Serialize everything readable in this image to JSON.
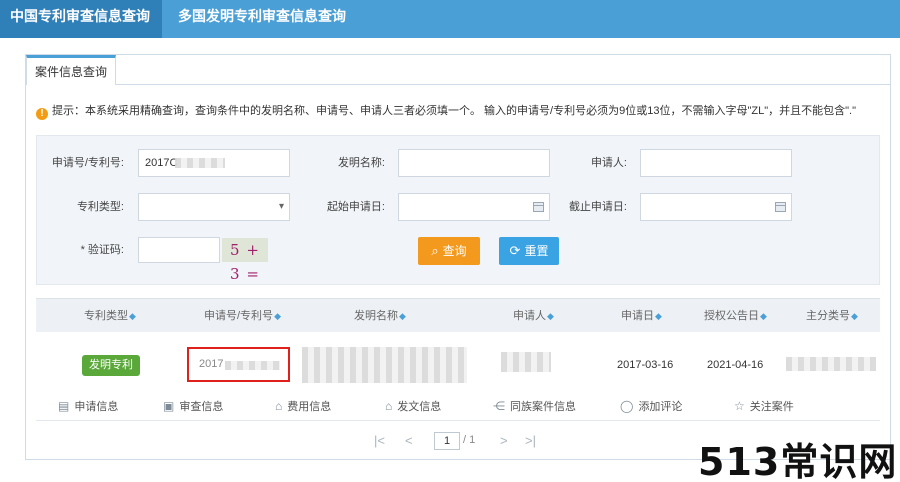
{
  "top_tabs": {
    "active": "中国专利审查信息查询",
    "other": "多国发明专利审查信息查询"
  },
  "panel_tab": "案件信息查询",
  "tip": {
    "icon": "warning-icon",
    "text": "提示：本系统采用精确查询，查询条件中的发明名称、申请号、申请人三者必须填一个。 输入的申请号/专利号必须为9位或13位，不需输入字母\"ZL\"，并且不能包含\".\""
  },
  "form": {
    "app_no_label": "申请号/专利号:",
    "app_no_value": "2017C",
    "invention_label": "发明名称:",
    "applicant_label": "申请人:",
    "type_label": "专利类型:",
    "start_date_label": "起始申请日:",
    "end_date_label": "截止申请日:",
    "captcha_label": "* 验证码:",
    "captcha_image": "5 + 3 =",
    "search_label": "查询",
    "reset_label": "重置"
  },
  "results": {
    "headers": [
      "专利类型",
      "申请号/专利号",
      "发明名称",
      "申请人",
      "申请日",
      "授权公告日",
      "主分类号"
    ],
    "row": {
      "type": "发明专利",
      "app_no": "2017",
      "filing_date": "2017-03-16",
      "grant_date": "2021-04-16"
    },
    "actions": [
      "申请信息",
      "审查信息",
      "费用信息",
      "发文信息",
      "同族案件信息",
      "添加评论",
      "关注案件"
    ]
  },
  "pager": {
    "first": "|<",
    "prev": "<",
    "current": "1",
    "total": "/ 1",
    "next": ">",
    "last": ">|"
  },
  "watermark": "513常识网",
  "colors": {
    "topbar": "#4a9fd7",
    "active_tab": "#2f7fb9",
    "search_button": "#f39a1e",
    "reset_button": "#3aa3e3",
    "badge": "#5aa83a",
    "highlight_box": "#e0201b"
  }
}
